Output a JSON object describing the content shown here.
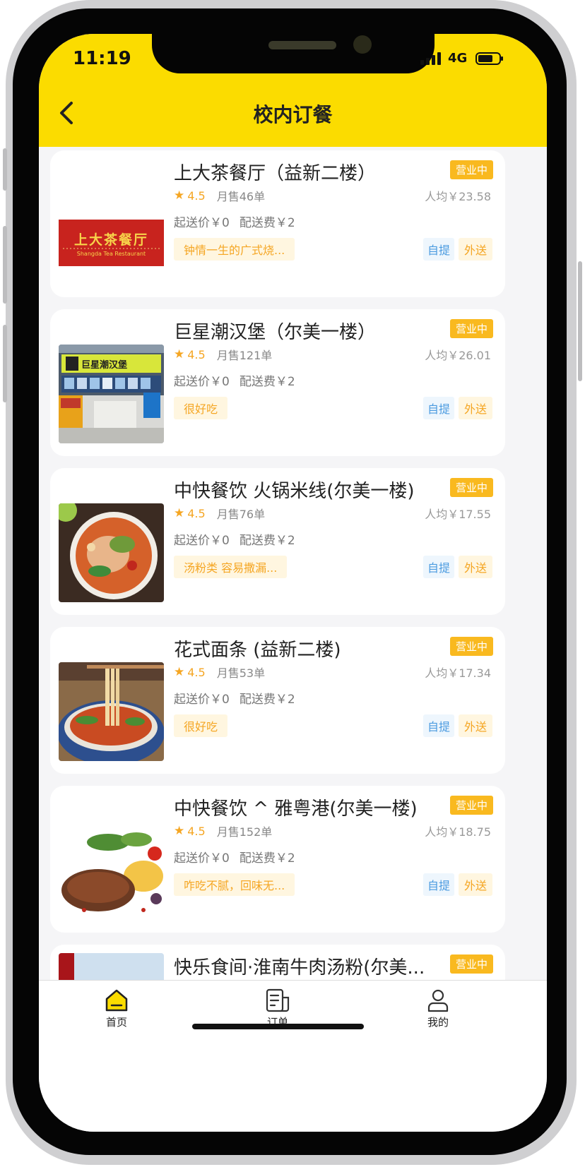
{
  "status_bar": {
    "time": "11:19",
    "network": "4G"
  },
  "header": {
    "title": "校内订餐",
    "back_icon": "chevron-left-icon"
  },
  "restaurants": [
    {
      "name": "上大茶餐厅（益新二楼）",
      "status": "营业中",
      "rating": "4.5",
      "monthly_sales": "月售46单",
      "avg_price": "人均￥23.58",
      "min_order": "起送价￥0",
      "delivery_fee": "配送费￥2",
      "tagline": "钟情一生的广式烧...",
      "pickup": "自提",
      "delivery": "外送",
      "logo_text": "上大茶餐厅",
      "logo_subtext": "Shangda Tea Restaurant"
    },
    {
      "name": "巨星潮汉堡（尔美一楼）",
      "status": "营业中",
      "rating": "4.5",
      "monthly_sales": "月售121单",
      "avg_price": "人均￥26.01",
      "min_order": "起送价￥0",
      "delivery_fee": "配送费￥2",
      "tagline": "很好吃",
      "pickup": "自提",
      "delivery": "外送",
      "sign_text": "巨星潮汉堡"
    },
    {
      "name": "中快餐饮 火锅米线(尔美一楼)",
      "status": "营业中",
      "rating": "4.5",
      "monthly_sales": "月售76单",
      "avg_price": "人均￥17.55",
      "min_order": "起送价￥0",
      "delivery_fee": "配送费￥2",
      "tagline": "汤粉类 容易撒漏...",
      "pickup": "自提",
      "delivery": "外送"
    },
    {
      "name": "花式面条 (益新二楼)",
      "status": "营业中",
      "rating": "4.5",
      "monthly_sales": "月售53单",
      "avg_price": "人均￥17.34",
      "min_order": "起送价￥0",
      "delivery_fee": "配送费￥2",
      "tagline": "很好吃",
      "pickup": "自提",
      "delivery": "外送"
    },
    {
      "name": "中快餐饮 ^ 雅粤港(尔美一楼)",
      "status": "营业中",
      "rating": "4.5",
      "monthly_sales": "月售152单",
      "avg_price": "人均￥18.75",
      "min_order": "起送价￥0",
      "delivery_fee": "配送费￥2",
      "tagline": "咋吃不腻，回味无...",
      "pickup": "自提",
      "delivery": "外送"
    },
    {
      "name": "快乐食间·淮南牛肉汤粉(尔美...",
      "status": "营业中"
    }
  ],
  "tabbar": {
    "items": [
      {
        "label": "首页",
        "icon": "home-icon"
      },
      {
        "label": "订单",
        "icon": "order-icon"
      },
      {
        "label": "我的",
        "icon": "profile-icon"
      }
    ]
  },
  "colors": {
    "brand_yellow": "#fbdc00",
    "badge_orange": "#f9b91f",
    "link_blue": "#4b9be0"
  }
}
